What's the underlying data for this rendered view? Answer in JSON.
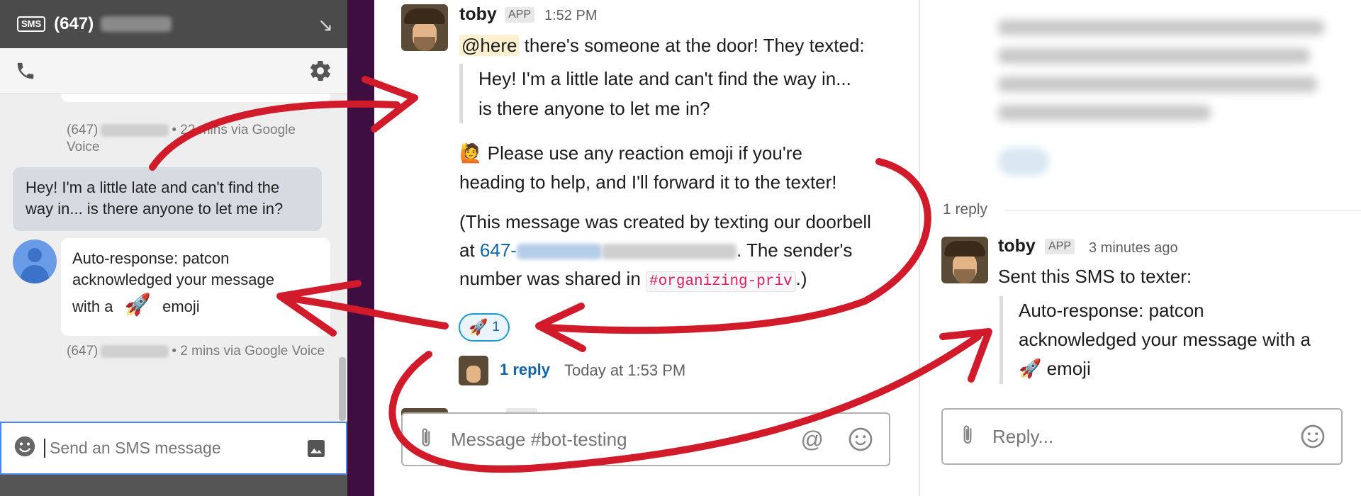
{
  "sms": {
    "badge": "SMS",
    "number": "(647)",
    "prev_meta_number": "(647)",
    "prev_meta_time": "• 22 mins via Google",
    "prev_meta_via": "Voice",
    "incoming": "Hey! I'm a little late and can't find the way in... is there anyone to let me in?",
    "auto_line1": "Auto-response: patcon",
    "auto_line2": "acknowledged your message",
    "auto_line3a": "with a",
    "auto_emoji": "🚀",
    "auto_line3b": "emoji",
    "auto_meta_number": "(647)",
    "auto_meta_time": "• 2 mins  via Google Voice",
    "input_placeholder": "Send an SMS message"
  },
  "message": {
    "sender": "toby",
    "badge": "APP",
    "time": "1:52 PM",
    "mention": "@here",
    "intro": " there's someone at the door! They texted:",
    "quote_line1": "Hey! I'm a little late and can't find the way in...",
    "quote_line2": "is there anyone to let me in?",
    "raise_emoji": "🙋",
    "instr_line1": " Please use any reaction emoji if you're",
    "instr_line2": "heading to help, and I'll forward it to the texter!",
    "note_line1": "(This message was created by texting our doorbell",
    "note_at": "at ",
    "note_phone": "647-",
    "note_sender": ". The sender's",
    "note_shared": "number was shared in ",
    "channel_code": "#organizing-priv",
    "note_end": ".)",
    "reaction_emoji": "🚀",
    "reaction_count": "1",
    "reply_count": "1 reply",
    "reply_time": "Today at 1:53 PM",
    "composer_placeholder": "Message #bot-testing",
    "at_symbol": "@"
  },
  "thread": {
    "reply_count": "1 reply",
    "sender": "toby",
    "badge": "APP",
    "time": "3 minutes ago",
    "text": "Sent this SMS to texter:",
    "quote_line1": "Auto-response: patcon",
    "quote_line2": "acknowledged your message with a",
    "quote_emoji": "🚀",
    "quote_line3": " emoji",
    "reply_placeholder": "Reply..."
  },
  "icons": [
    "phone-icon",
    "gear-icon",
    "expand-icon",
    "smiley-icon",
    "image-icon",
    "paperclip-icon",
    "at-icon",
    "avatar-icon"
  ],
  "colors": {
    "slack_link": "#1264a3",
    "mention_bg": "#fdf0cf",
    "code_red": "#e01e5a",
    "arrow_red": "#d11a2a",
    "sidebar": "#3f0e40",
    "sms_header": "#4b4b4b"
  }
}
